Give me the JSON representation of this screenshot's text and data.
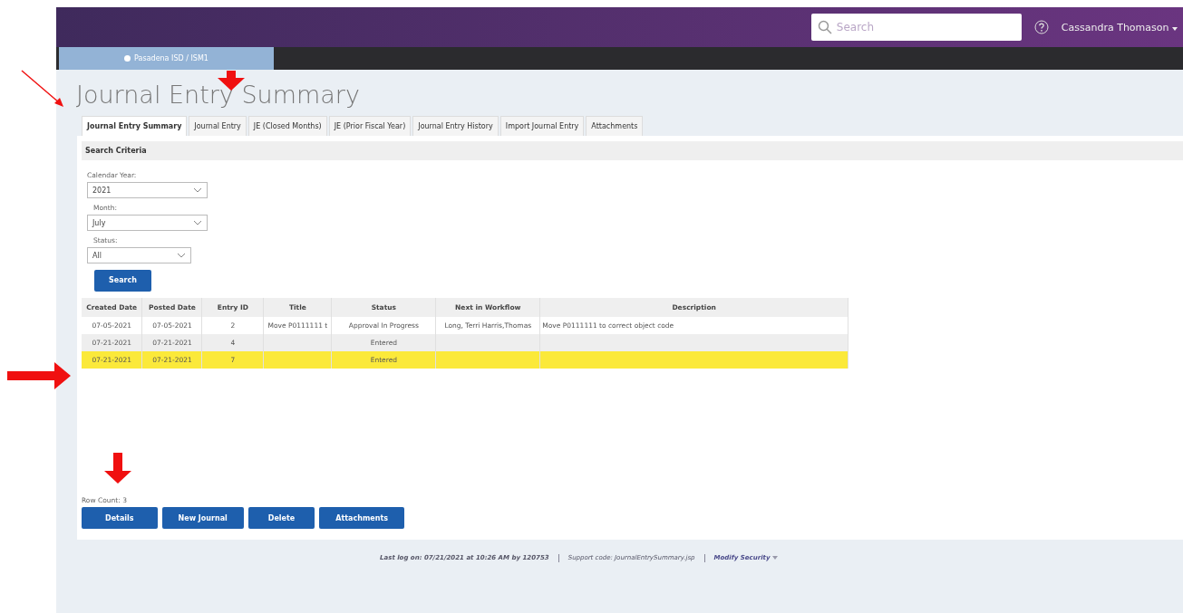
{
  "header": {
    "search": {
      "placeholder": "Search"
    },
    "user": "Cassandra Thomason"
  },
  "location_tab": "Pasadena ISD / ISM1",
  "page_title": "Journal Entry Summary",
  "tabs": [
    {
      "label": "Journal Entry Summary",
      "selected": true
    },
    {
      "label": "Journal Entry",
      "selected": false
    },
    {
      "label": "JE (Closed Months)",
      "selected": false
    },
    {
      "label": "JE (Prior Fiscal Year)",
      "selected": false
    },
    {
      "label": "Journal Entry History",
      "selected": false
    },
    {
      "label": "Import Journal Entry",
      "selected": false
    },
    {
      "label": "Attachments",
      "selected": false
    }
  ],
  "search_criteria": {
    "title": "Search Criteria",
    "fields": [
      {
        "label": "Calendar Year:",
        "value": "2021"
      },
      {
        "label": "Month:",
        "value": "July"
      },
      {
        "label": "Status:",
        "value": "All"
      }
    ],
    "button": "Search"
  },
  "table": {
    "columns": [
      "Created Date",
      "Posted Date",
      "Entry ID",
      "Title",
      "Status",
      "Next in Workflow",
      "Description"
    ],
    "rows": [
      {
        "selected": false,
        "cells": [
          "07-05-2021",
          "07-05-2021",
          "2",
          "Move P0111111 t",
          "Approval In Progress",
          "Long, Terri Harris,Thomas",
          "Move P0111111 to correct object code"
        ]
      },
      {
        "selected": false,
        "cells": [
          "07-21-2021",
          "07-21-2021",
          "4",
          "",
          "Entered",
          "",
          ""
        ]
      },
      {
        "selected": true,
        "cells": [
          "07-21-2021",
          "07-21-2021",
          "7",
          "",
          "Entered",
          "",
          ""
        ]
      }
    ]
  },
  "row_count": "Row Count: 3",
  "buttons": [
    "Details",
    "New Journal",
    "Delete",
    "Attachments"
  ],
  "footer": {
    "last_log": "Last log on: 07/21/2021 at 10:26 AM by 120753",
    "support": "Support code: JournalEntrySummary.jsp",
    "security": "Modify Security"
  }
}
